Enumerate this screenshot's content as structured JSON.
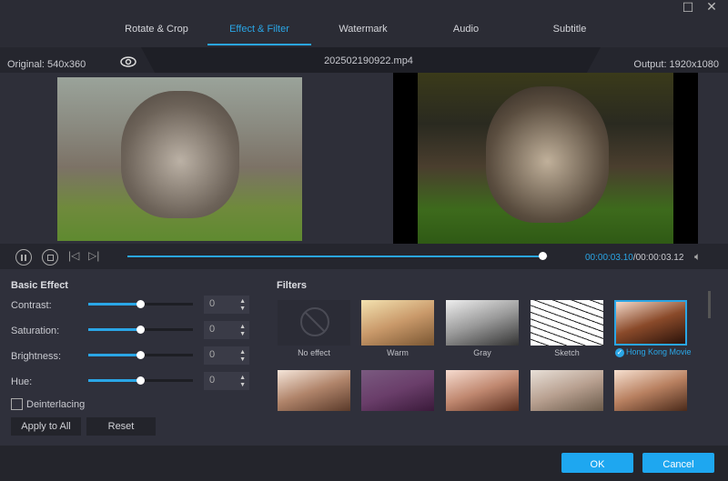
{
  "window": {
    "maximize_icon": "square-icon",
    "close_icon": "x-icon"
  },
  "tabs": [
    {
      "label": "Rotate & Crop"
    },
    {
      "label": "Effect & Filter",
      "active": true
    },
    {
      "label": "Watermark"
    },
    {
      "label": "Audio"
    },
    {
      "label": "Subtitle"
    }
  ],
  "info": {
    "original": "Original: 540x360",
    "filename": "202502190922.mp4",
    "output": "Output: 1920x1080"
  },
  "player": {
    "current_time": "00:00:03.10",
    "total_time": "/00:00:03.12",
    "progress_percent": 99
  },
  "basic_effect": {
    "title": "Basic Effect",
    "sliders": [
      {
        "label": "Contrast:",
        "value": "0"
      },
      {
        "label": "Saturation:",
        "value": "0"
      },
      {
        "label": "Brightness:",
        "value": "0"
      },
      {
        "label": "Hue:",
        "value": "0"
      }
    ],
    "deinterlacing": "Deinterlacing",
    "deinterlacing_checked": false,
    "apply_all": "Apply to All",
    "reset": "Reset"
  },
  "filters": {
    "title": "Filters",
    "items": [
      {
        "label": "No effect"
      },
      {
        "label": "Warm"
      },
      {
        "label": "Gray"
      },
      {
        "label": "Sketch"
      },
      {
        "label": "Hong Kong Movie",
        "selected": true
      }
    ]
  },
  "footer": {
    "ok": "OK",
    "cancel": "Cancel"
  },
  "colors": {
    "accent": "#2aa6e6",
    "ok_button": "#1ea7f0"
  }
}
